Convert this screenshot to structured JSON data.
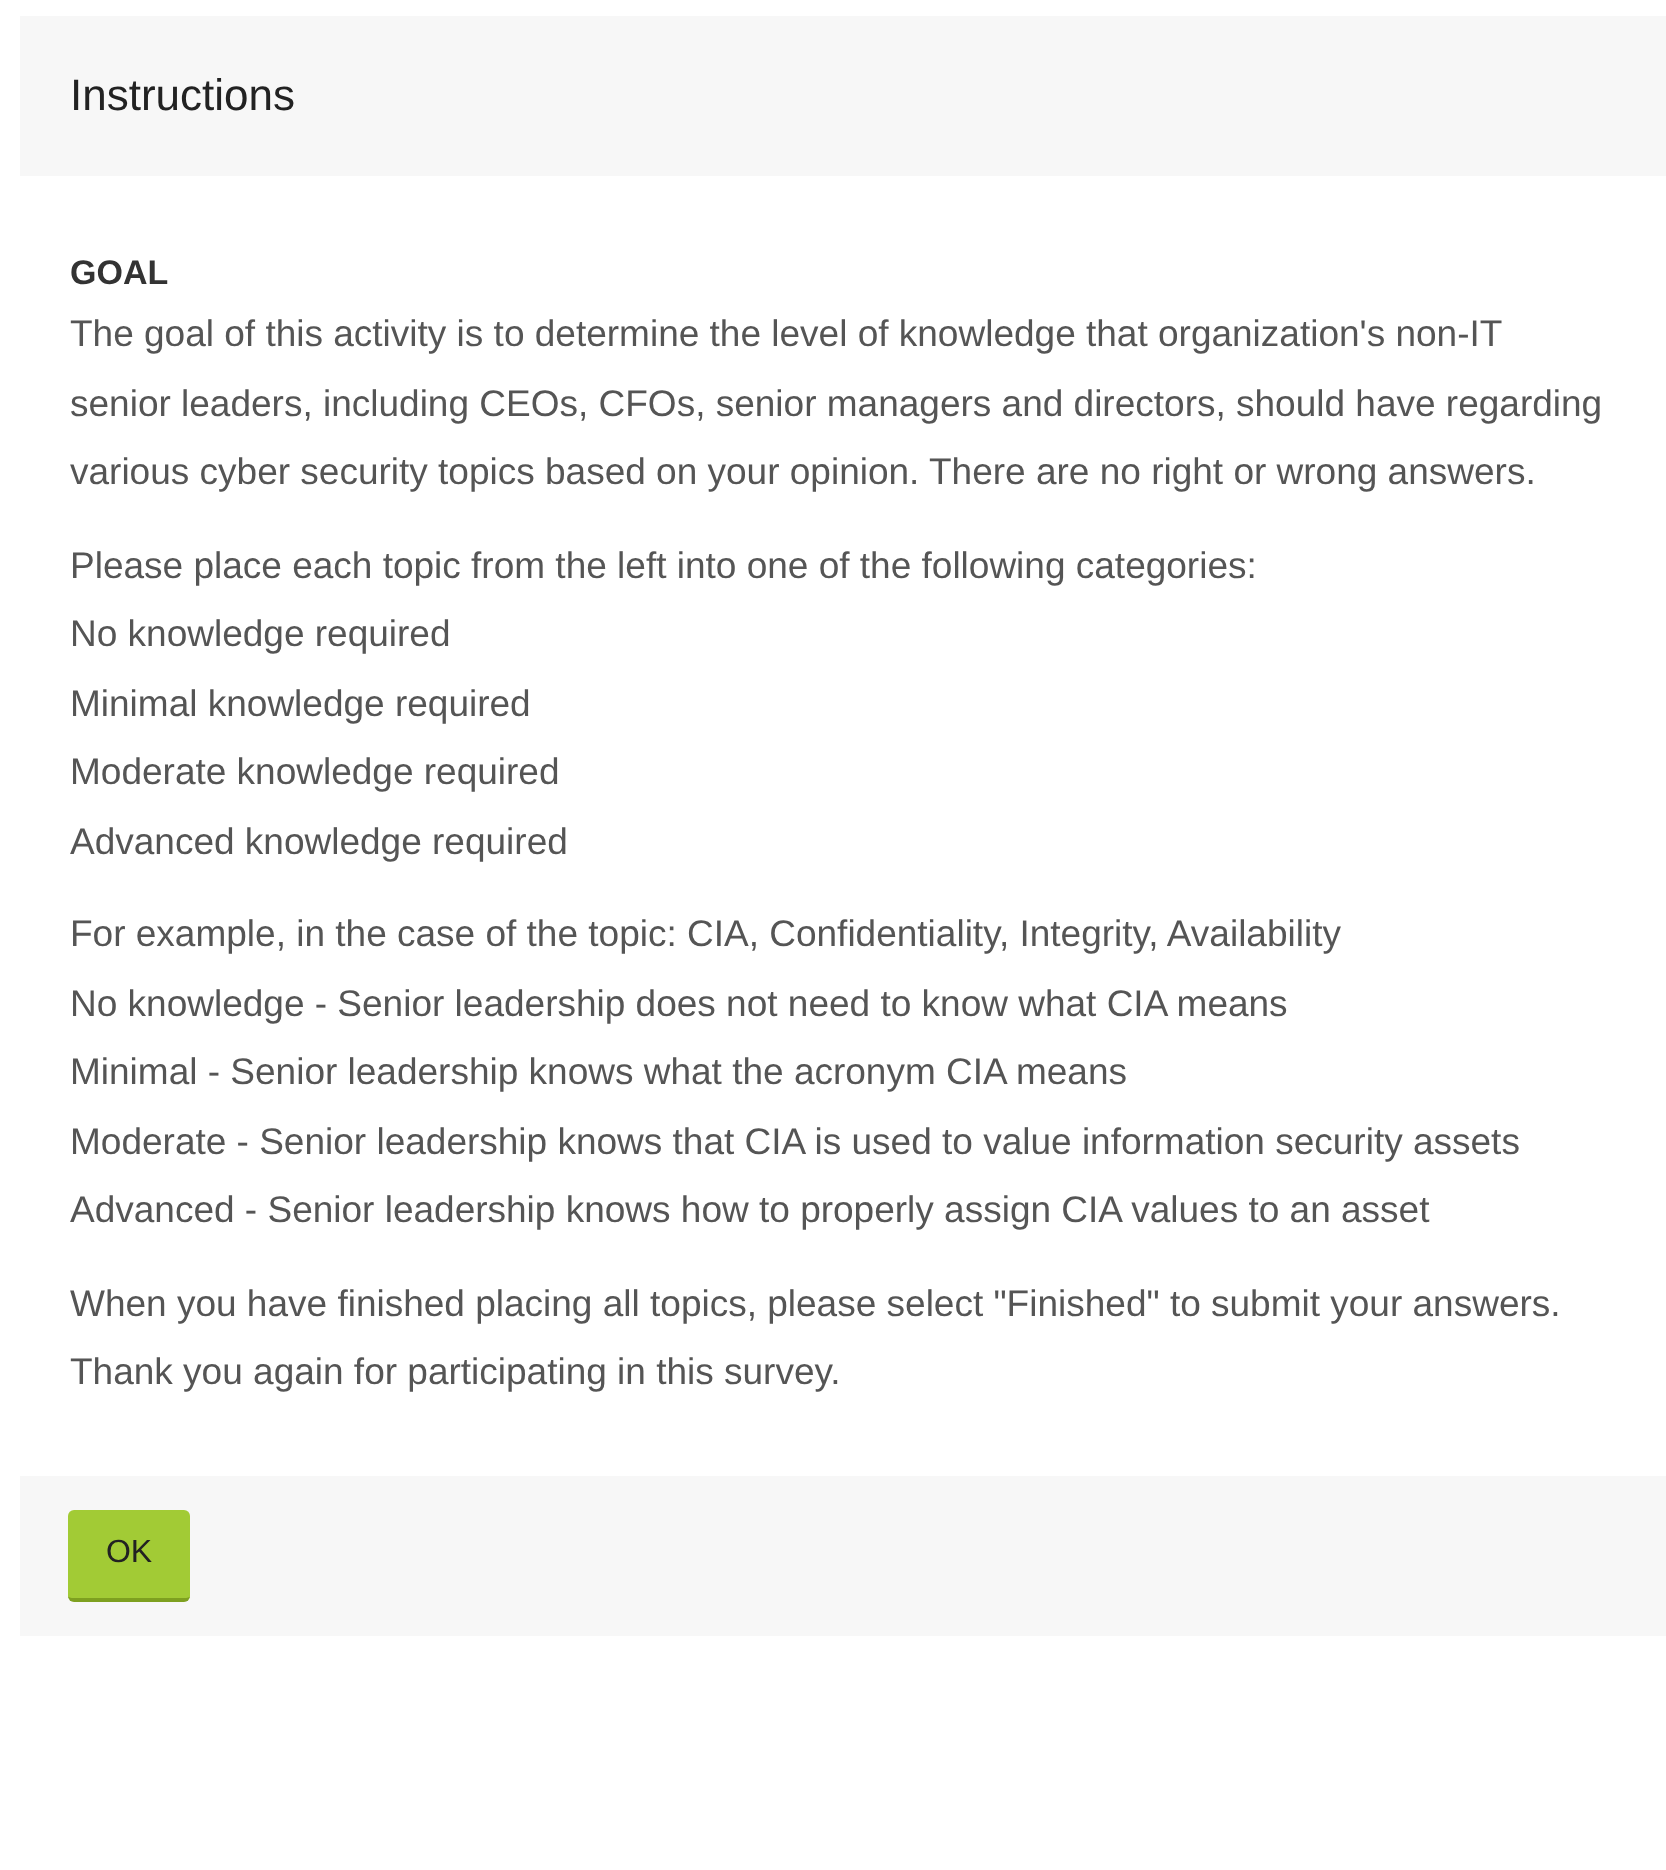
{
  "dialog": {
    "title": "Instructions",
    "heading": "GOAL",
    "paragraphs": [
      {
        "lines": [
          "The goal of this activity is to determine the level of knowledge that organization's non-IT senior leaders, including CEOs, CFOs, senior managers and directors, should have regarding various cyber security topics based on your opinion. There are no right or wrong answers."
        ]
      },
      {
        "lines": [
          "Please place each topic from the left into one of the following categories:",
          "No knowledge required",
          "Minimal knowledge required",
          "Moderate knowledge required",
          "Advanced knowledge required"
        ]
      },
      {
        "lines": [
          "For example, in the case of the topic: CIA, Confidentiality, Integrity, Availability",
          "No knowledge - Senior leadership does not need to know what CIA means",
          "Minimal - Senior leadership knows what the acronym CIA means",
          "Moderate - Senior leadership knows that CIA is used to value information security assets",
          "Advanced - Senior leadership knows how to properly assign CIA values to an asset"
        ]
      },
      {
        "lines": [
          "When you have finished placing all topics, please select \"Finished\" to submit your answers. Thank you again for participating in this survey."
        ]
      }
    ],
    "buttons": [
      "OK"
    ]
  }
}
